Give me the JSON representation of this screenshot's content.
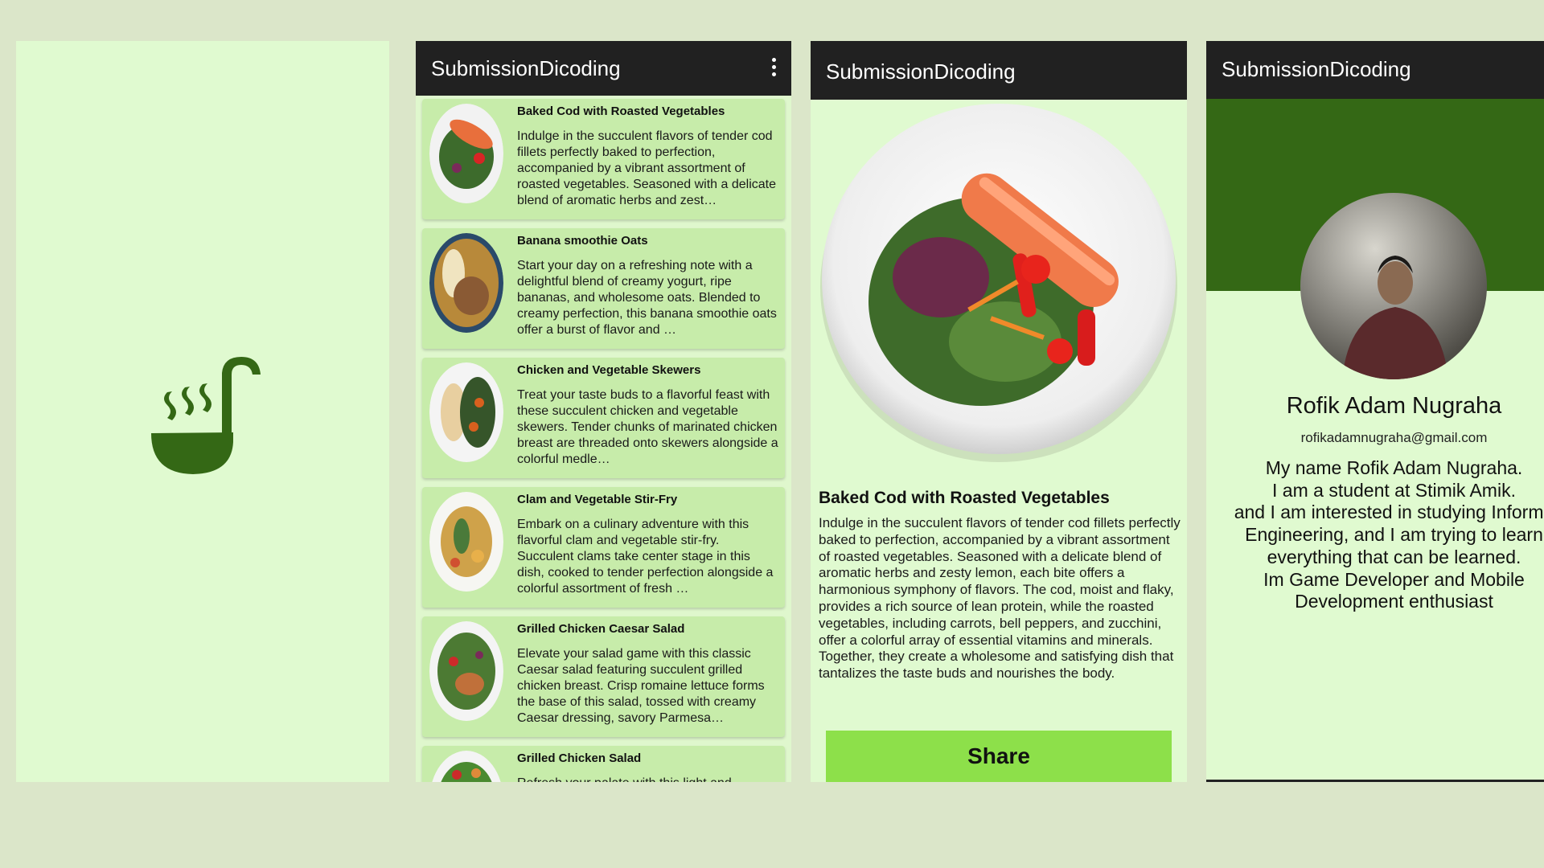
{
  "colors": {
    "background": "#dbe6c9",
    "panel": "#e0fad0",
    "card": "#c7ecaa",
    "appbar": "#212121",
    "brand_green": "#346815",
    "share_button": "#8de04a"
  },
  "splash": {
    "logo_icon": "ladle-steam-icon"
  },
  "list_screen": {
    "app_title": "SubmissionDicoding",
    "menu_icon": "more-vert-icon",
    "items": [
      {
        "name": "Baked Cod with Roasted Vegetables",
        "description": "Indulge in the succulent flavors of tender cod fillets perfectly baked to perfection, accompanied by a vibrant assortment of roasted vegetables. Seasoned with a delicate blend of aromatic herbs and zest…"
      },
      {
        "name": "Banana smoothie Oats",
        "description": "Start your day on a refreshing note with a delightful blend of creamy yogurt, ripe bananas, and wholesome oats. Blended to creamy perfection, this banana smoothie oats offer a burst of flavor and …"
      },
      {
        "name": "Chicken and Vegetable Skewers",
        "description": "Treat your taste buds to a flavorful feast with these succulent chicken and vegetable skewers. Tender chunks of marinated chicken breast are threaded onto skewers alongside a colorful medle…"
      },
      {
        "name": "Clam and Vegetable Stir-Fry",
        "description": "Embark on a culinary adventure with this flavorful clam and vegetable stir-fry. Succulent clams take center stage in this dish, cooked to tender perfection alongside a colorful assortment of fresh …"
      },
      {
        "name": "Grilled Chicken Caesar Salad",
        "description": "Elevate your salad game with this classic Caesar salad featuring succulent grilled chicken breast. Crisp romaine lettuce forms the base of this salad, tossed with creamy Caesar dressing, savory Parmesa…"
      },
      {
        "name": "Grilled Chicken Salad",
        "description": "Refresh your palate with this light and"
      }
    ]
  },
  "detail_screen": {
    "app_title": "SubmissionDicoding",
    "title": "Baked Cod with Roasted Vegetables",
    "description": "Indulge in the succulent flavors of tender cod fillets perfectly baked to perfection, accompanied by a vibrant assortment of roasted vegetables. Seasoned with a delicate blend of aromatic herbs and zesty lemon, each bite offers a harmonious symphony of flavors. The cod, moist and flaky, provides a rich source of lean protein, while the roasted vegetables, including carrots, bell peppers, and zucchini, offer a colorful array of essential vitamins and minerals. Together, they create a wholesome and satisfying dish that tantalizes the taste buds and nourishes the body.",
    "share_label": "Share"
  },
  "profile_screen": {
    "app_title": "SubmissionDicoding",
    "name": "Rofik Adam Nugraha",
    "email": "rofikadamnugraha@gmail.com",
    "bio": "My name Rofik Adam Nugraha.\nI am a student at Stimik Amik.\nand I am interested in studying Informa\nEngineering, and I am trying to learn\neverything that can be learned.\nIm Game Developer and Mobile\nDevelopment enthusiast"
  }
}
